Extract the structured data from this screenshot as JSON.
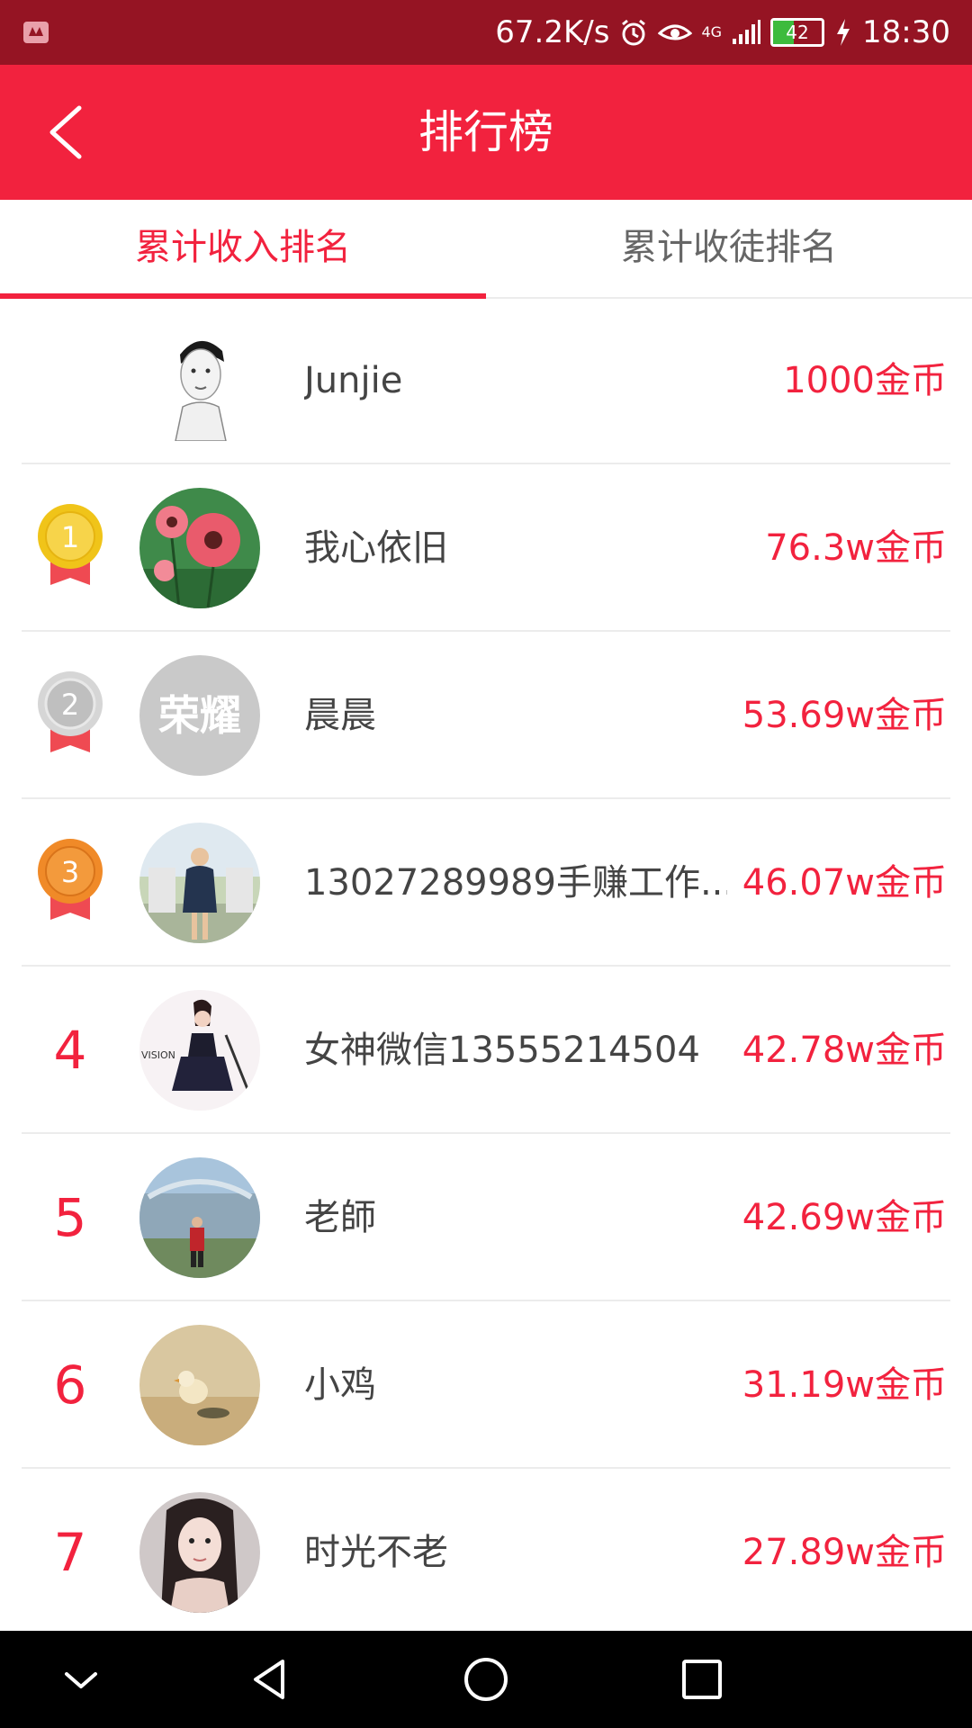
{
  "status_bar": {
    "network_speed": "67.2K/s",
    "network_type": "4G",
    "battery_level": "42",
    "time": "18:30",
    "icons": [
      "huawei-icon",
      "alarm-icon",
      "eye-icon",
      "signal-icon",
      "battery-icon",
      "charging-icon"
    ]
  },
  "app_bar": {
    "title": "排行榜",
    "back_icon": "back-arrow-icon"
  },
  "tabs": [
    {
      "label": "累计收入排名",
      "active": true
    },
    {
      "label": "累计收徒排名",
      "active": false
    }
  ],
  "colors": {
    "accent": "#f2223e",
    "status_bar": "#951423",
    "text_primary": "#444444",
    "text_tab_inactive": "#666666",
    "gold": "#f0c419",
    "silver": "#c9c9c9",
    "bronze": "#f08a28"
  },
  "entries": [
    {
      "rank": "",
      "rank_type": "self",
      "name": "Junjie",
      "amount": "1000金币"
    },
    {
      "rank": "1",
      "rank_type": "gold",
      "name": "我心依旧",
      "amount": "76.3w金币"
    },
    {
      "rank": "2",
      "rank_type": "silver",
      "name": "晨晨",
      "amount": "53.69w金币",
      "avatar_text": "荣耀"
    },
    {
      "rank": "3",
      "rank_type": "bronze",
      "name": "13027289989手赚工作...",
      "amount": "46.07w金币"
    },
    {
      "rank": "4",
      "rank_type": "number",
      "name": "女神微信13555214504",
      "amount": "42.78w金币",
      "avatar_text": "VISION"
    },
    {
      "rank": "5",
      "rank_type": "number",
      "name": "老師",
      "amount": "42.69w金币"
    },
    {
      "rank": "6",
      "rank_type": "number",
      "name": "小鸡",
      "amount": "31.19w金币"
    },
    {
      "rank": "7",
      "rank_type": "number",
      "name": "时光不老",
      "amount": "27.89w金币"
    }
  ],
  "nav_bar": {
    "buttons": [
      "collapse-icon",
      "back-triangle-icon",
      "home-circle-icon",
      "recents-square-icon"
    ]
  }
}
